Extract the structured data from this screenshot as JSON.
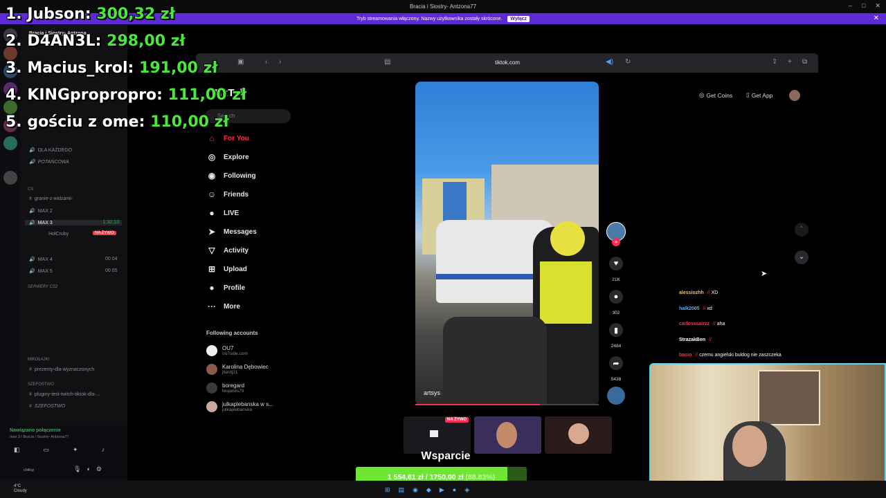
{
  "window": {
    "title": "Bracia i Siostry- Antzona77",
    "controls": [
      "–",
      "□",
      "✕"
    ]
  },
  "stream_banner": {
    "text": "Tryb streamowania włączony. Nazwy użytkownika zostały skrócone.",
    "button": "Wyłącz",
    "close": "✕"
  },
  "leaderboard": [
    {
      "rank_name": "1. Jubson:",
      "amount": "300,32 zł"
    },
    {
      "rank_name": "2. D4AN3L:",
      "amount": "298,00 zł"
    },
    {
      "rank_name": "3. Macius_krol:",
      "amount": "191,00 zł"
    },
    {
      "rank_name": "4. KINGpropropro:",
      "amount": "111,00 zł"
    },
    {
      "rank_name": "5. gościu z ome:",
      "amount": "110,00 zł"
    }
  ],
  "discord": {
    "server_name": "Bracia i Siostry- Antzona...",
    "channels": {
      "dla_kazdego": "DLA KAŻDEGO",
      "potancowa": "POTAŃCOWA",
      "cs_category": "CS",
      "granie": "granie-z-widzami-",
      "max2": "MAX 2",
      "max3": "MAX 3",
      "max3_time": "1:32:13",
      "user1": "HołCruby",
      "live_label": "NA ŻYWO",
      "max4": "MAX 4",
      "max5": "MAX 5",
      "max4_count": "00 04",
      "max5_count": "00 05",
      "serwery_cat": "SERWERY CS2",
      "mikolajki_cat": "MIKOŁAJKI",
      "prezenty": "prezenty-dla-wyznaczonych",
      "szefostwo_cat": "SZEFOSTWO",
      "pluginy": "pluginy-test-twitch-tiktok-dla-...",
      "szefostwo": "SZEFOSTWO"
    },
    "voice": {
      "status": "Nawiązano połączenie",
      "channel": "max 3 / Bracia i Siostry- Antzona77",
      "user": "chilluy"
    }
  },
  "browser": {
    "url": "tiktok.com"
  },
  "tiktok": {
    "logo": "TikTok",
    "search_placeholder": "Search",
    "nav": [
      {
        "icon": "home-icon",
        "glyph": "⌂",
        "label": "For You",
        "active": true
      },
      {
        "icon": "explore-icon",
        "glyph": "◎",
        "label": "Explore",
        "active": false
      },
      {
        "icon": "following-icon",
        "glyph": "◉",
        "label": "Following",
        "active": false
      },
      {
        "icon": "friends-icon",
        "glyph": "☺",
        "label": "Friends",
        "active": false
      },
      {
        "icon": "live-icon",
        "glyph": "●",
        "label": "LIVE",
        "active": false
      },
      {
        "icon": "messages-icon",
        "glyph": "➤",
        "label": "Messages",
        "active": false
      },
      {
        "icon": "activity-icon",
        "glyph": "▽",
        "label": "Activity",
        "active": false
      },
      {
        "icon": "upload-icon",
        "glyph": "⊞",
        "label": "Upload",
        "active": false
      },
      {
        "icon": "profile-icon",
        "glyph": "●",
        "label": "Profile",
        "active": false
      },
      {
        "icon": "more-icon",
        "glyph": "···",
        "label": "More",
        "active": false
      }
    ],
    "following_title": "Following accounts",
    "accounts": [
      {
        "name": "OU7",
        "handle": "ou7side.com"
      },
      {
        "name": "Karolina Dębowiec",
        "handle": "jtwrdj21"
      },
      {
        "name": "boregard",
        "handle": "leojanes79"
      },
      {
        "name": "julkaplebanska w s...",
        "handle": "julkaplebanska"
      }
    ],
    "get_coins": "Get Coins",
    "get_app": "Get App",
    "video_username": "artsys",
    "video_progress": 0.68,
    "actions": {
      "likes": "21K",
      "comments": "302",
      "saves": "2484",
      "shares": "5438"
    }
  },
  "chat": [
    {
      "user": "alessiozhh",
      "color": "#f0c060",
      "message": "XD"
    },
    {
      "user": "halk2005",
      "color": "#6aa8ff",
      "message": "xd"
    },
    {
      "user": "carlosssairzz",
      "color": "#e0405a",
      "message": "aha"
    },
    {
      "user": "StrazakBen",
      "color": "#ffffff",
      "message": ""
    },
    {
      "user": "basio",
      "color": "#e0405a",
      "message": "czemu angielski buldog nie zaszczeka"
    }
  ],
  "support": {
    "live_badge": "NA ŻYWO",
    "title": "Wsparcie",
    "goal_current": "1 554,61 zł",
    "goal_target": "1750,00 zł",
    "goal_percent": "(88.83%)",
    "goal_fraction": 0.8883
  },
  "taskbar": {
    "weather_temp": "4°C",
    "weather_desc": "Cloudy"
  }
}
